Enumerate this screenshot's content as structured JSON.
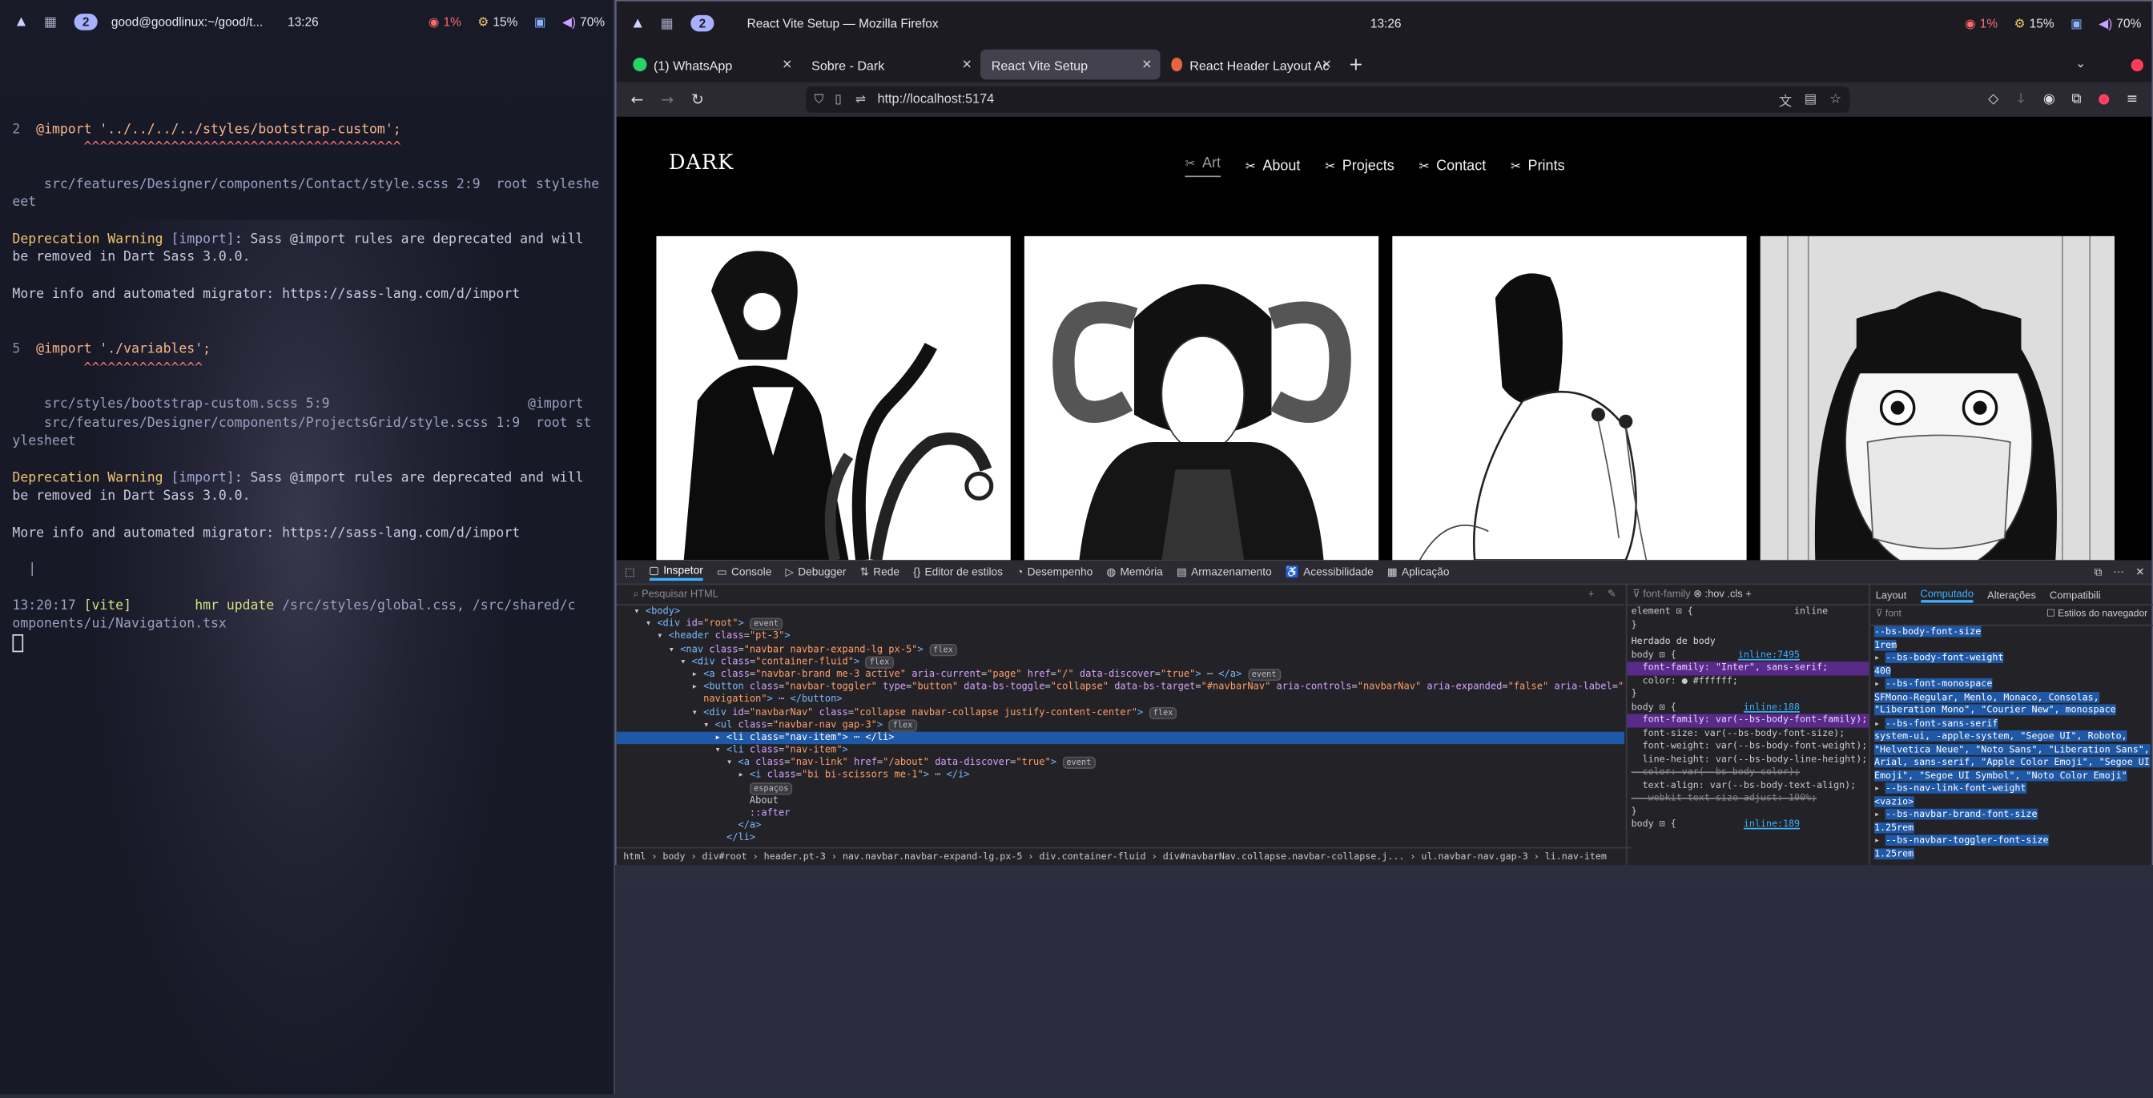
{
  "left_bar": {
    "title": "good@goodlinux:~/good/t...",
    "time": "13:26",
    "cpu": "1%",
    "mem": "15%",
    "vol": "70%",
    "ws_active": "2"
  },
  "terminal": {
    "lines": [
      {
        "n": "2",
        "code": "@import '../../../../styles/bootstrap-custom';"
      },
      {
        "carets": "^^^^^^^^^^^^^^^^^^^^^^^^^^^^^^^^^^^^^^^^"
      },
      {
        "path": "    src/features/Designer/components/Contact/style.scss 2:9  root styleshe"
      },
      {
        "path": "eet"
      },
      {
        "warn": "Deprecation Warning",
        "tag": "[import]",
        "msg": ": Sass @import rules are deprecated and will"
      },
      {
        "text": "be removed in Dart Sass 3.0.0."
      },
      {
        "text": "More info and automated migrator: https://sass-lang.com/d/import"
      },
      {
        "n": "5",
        "code": "@import './variables';"
      },
      {
        "carets": "^^^^^^^^^^^^^^^"
      },
      {
        "path": "    src/styles/bootstrap-custom.scss 5:9                         @import"
      },
      {
        "path": "    src/features/Designer/components/ProjectsGrid/style.scss 1:9  root st"
      },
      {
        "path": "ylesheet"
      },
      {
        "warn": "Deprecation Warning",
        "tag": "[import]",
        "msg": ": Sass @import rules are deprecated and will"
      },
      {
        "text": "be removed in Dart Sass 3.0.0."
      },
      {
        "text": "More info and automated migrator: https://sass-lang.com/d/import"
      },
      {
        "pipe": "|"
      },
      {
        "time": "13:20:17",
        "vite": "[vite]",
        "hmr": "hmr update",
        "files": "/src/styles/global.css, /src/shared/c"
      },
      {
        "text": "omponents/ui/Navigation.tsx"
      }
    ]
  },
  "firefox": {
    "window_title": "React Vite Setup — Mozilla Firefox",
    "time": "13:26",
    "tabs": [
      {
        "label": "(1) WhatsApp",
        "color": "#25d366"
      },
      {
        "label": "Sobre - Dark",
        "color": ""
      },
      {
        "label": "React Vite Setup",
        "color": ""
      },
      {
        "label": "React Header Layout Ac",
        "color": "#e8643c"
      }
    ],
    "new_tab": "+",
    "url": "http://localhost:5174"
  },
  "site": {
    "brand": "DARK",
    "nav": [
      "Art",
      "About",
      "Projects",
      "Contact",
      "Prints"
    ]
  },
  "devtools": {
    "tabs": [
      "Inspetor",
      "Console",
      "Debugger",
      "Rede",
      "Editor de estilos",
      "Desempenho",
      "Memória",
      "Armazenamento",
      "Acessibilidade",
      "Aplicação"
    ],
    "search_placeholder": "Pesquisar HTML",
    "breadcrumbs": "html  ›  body  ›  div#root  ›  header.pt-3  ›  nav.navbar.navbar-expand-lg.px-5  ›  div.container-fluid  ›  div#navbarNav.collapse.navbar-collapse.j...  ›  ul.navbar-nav.gap-3  ›  li.nav-item",
    "rules_filter": "font-family",
    "computed_filter": "font",
    "computed_tabs": [
      "Layout",
      "Computado",
      "Alterações",
      "Compatibili"
    ],
    "browser_styles_label": "Estilos do navegador"
  }
}
